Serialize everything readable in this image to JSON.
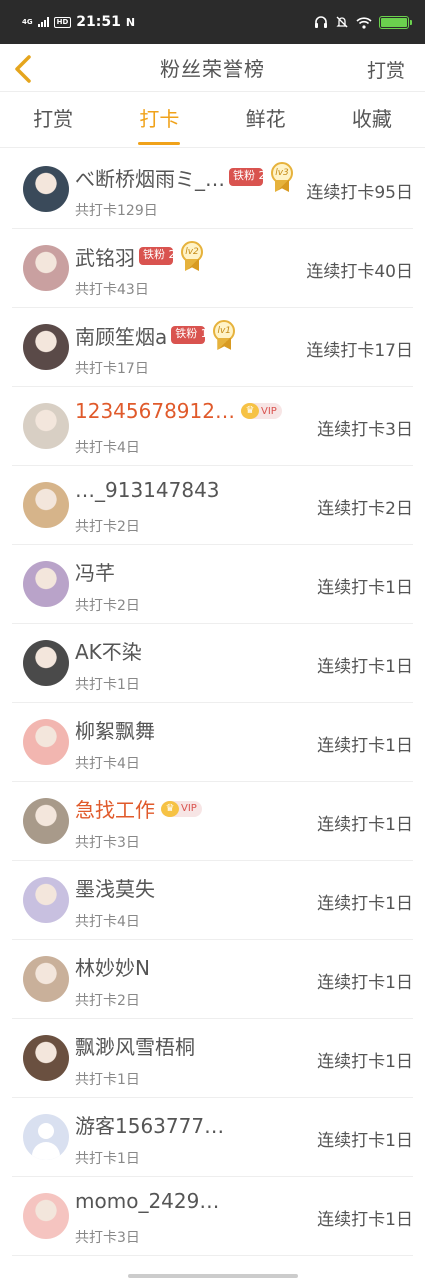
{
  "status_bar": {
    "network": "4G",
    "hd": "HD",
    "time": "21:51",
    "notice_icon": "N"
  },
  "nav": {
    "title": "粉丝荣誉榜",
    "action": "打赏"
  },
  "tabs": [
    {
      "label": "打赏",
      "active": false
    },
    {
      "label": "打卡",
      "active": true
    },
    {
      "label": "鲜花",
      "active": false
    },
    {
      "label": "收藏",
      "active": false
    }
  ],
  "rows": [
    {
      "name": "べ断桥烟雨ミ_…",
      "tag": "铁粉 2",
      "medal": "lv3",
      "total": "共打卡129日",
      "streak": "连续打卡95日",
      "vip": false,
      "avatar": "#3a4a5a"
    },
    {
      "name": "武铭羽",
      "tag": "铁粉 2",
      "medal": "lv2",
      "total": "共打卡43日",
      "streak": "连续打卡40日",
      "vip": false,
      "avatar": "#c9a0a0"
    },
    {
      "name": "南顾笙烟a",
      "tag": "铁粉 1",
      "medal": "lv1",
      "total": "共打卡17日",
      "streak": "连续打卡17日",
      "vip": false,
      "avatar": "#5a4a48"
    },
    {
      "name": "12345678912…",
      "vip_label": "VIP",
      "total": "共打卡4日",
      "streak": "连续打卡3日",
      "vip": true,
      "avatar": "#d8cfc4"
    },
    {
      "name": "…_913147843",
      "total": "共打卡2日",
      "streak": "连续打卡2日",
      "vip": false,
      "avatar": "#d6b48a"
    },
    {
      "name": "冯芊",
      "total": "共打卡2日",
      "streak": "连续打卡1日",
      "vip": false,
      "avatar": "#b9a3c9"
    },
    {
      "name": "AK不染",
      "total": "共打卡1日",
      "streak": "连续打卡1日",
      "vip": false,
      "avatar": "#4a4a4a"
    },
    {
      "name": "柳絮飘舞",
      "total": "共打卡4日",
      "streak": "连续打卡1日",
      "vip": false,
      "avatar": "#f2b6b0"
    },
    {
      "name": "急找工作",
      "vip_label": "VIP",
      "total": "共打卡3日",
      "streak": "连续打卡1日",
      "vip": true,
      "avatar": "#a89a8a"
    },
    {
      "name": "墨浅莫失",
      "total": "共打卡4日",
      "streak": "连续打卡1日",
      "vip": false,
      "avatar": "#c8c0e0"
    },
    {
      "name": "林妙妙N",
      "total": "共打卡2日",
      "streak": "连续打卡1日",
      "vip": false,
      "avatar": "#c9b09a"
    },
    {
      "name": "飘渺风雪梧桐",
      "total": "共打卡1日",
      "streak": "连续打卡1日",
      "vip": false,
      "avatar": "#6a5040"
    },
    {
      "name": "游客1563777…",
      "total": "共打卡1日",
      "streak": "连续打卡1日",
      "vip": false,
      "avatar": "guest"
    },
    {
      "name": "momo_2429…",
      "total": "共打卡3日",
      "streak": "连续打卡1日",
      "vip": false,
      "avatar": "#f5c4c0"
    }
  ],
  "colors": {
    "accent": "#f0a21a",
    "tag": "#d9534f",
    "vip_name": "#e05a2b"
  }
}
